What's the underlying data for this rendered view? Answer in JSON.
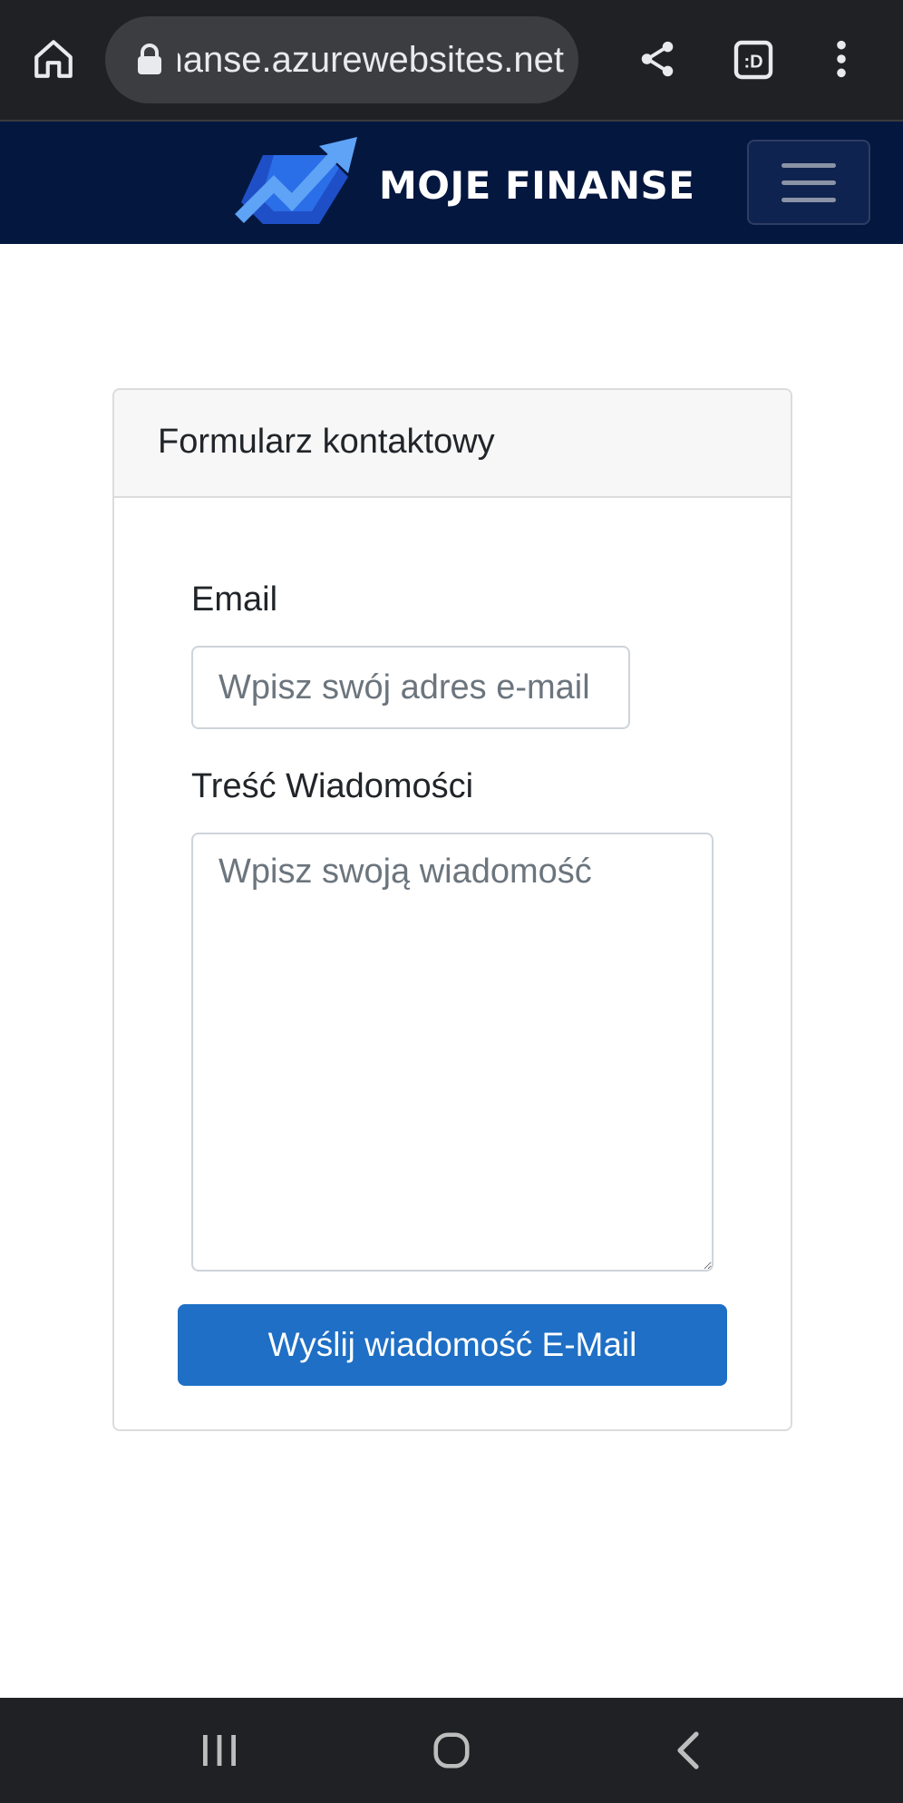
{
  "browser": {
    "url": "finanse.azurewebsites.net",
    "icons": {
      "home": "home-icon",
      "lock": "lock-icon",
      "share": "share-icon",
      "tabs": "tab-switcher-icon",
      "menu": "more-vert-icon"
    },
    "tab_switcher_label": ":D"
  },
  "navbar": {
    "brand_name": "MOJE FINANSE",
    "logo_icon": "trend-arrow-logo",
    "toggler_icon": "hamburger-menu-icon"
  },
  "contact_form": {
    "title": "Formularz kontaktowy",
    "email_label": "Email",
    "email_placeholder": "Wpisz swój adres e-mail",
    "email_value": "",
    "message_label": "Treść Wiadomości",
    "message_placeholder": "Wpisz swoją wiadomość",
    "message_value": "",
    "submit_label": "Wyślij wiadomość E-Mail"
  },
  "android_nav": {
    "icons": [
      "recents-icon",
      "home-circle-icon",
      "back-chevron-icon"
    ]
  },
  "colors": {
    "navbar_bg": "#04173f",
    "button_bg": "#1e6fc5",
    "chrome_bg": "#202124",
    "logo_blue": "#2a6ee8",
    "logo_light_blue": "#5ea3f5"
  }
}
